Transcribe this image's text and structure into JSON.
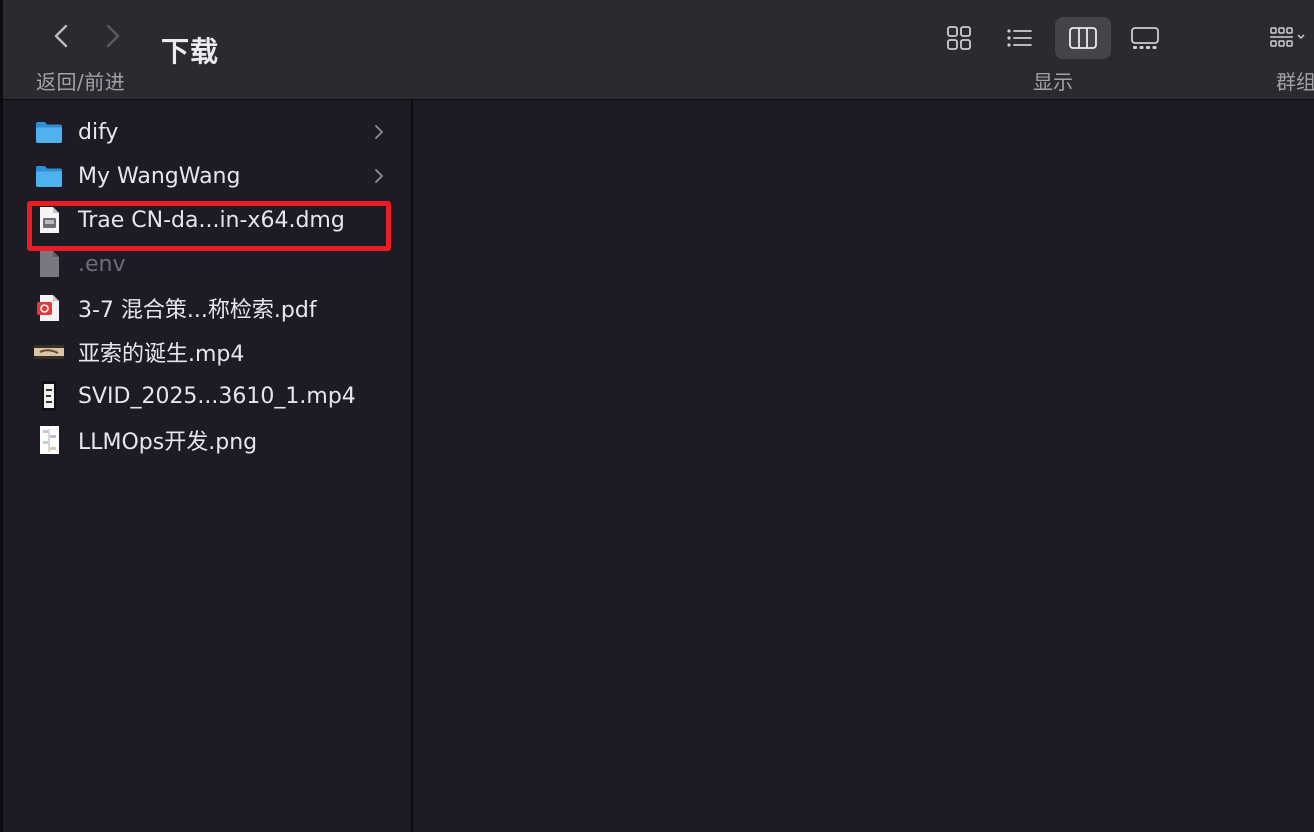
{
  "toolbar": {
    "nav_caption": "返回/前进",
    "title": "下载",
    "display_caption": "显示",
    "group_caption": "群组"
  },
  "files": [
    {
      "name": "dify",
      "kind": "folder",
      "has_children": true
    },
    {
      "name": "My WangWang",
      "kind": "folder",
      "has_children": true
    },
    {
      "name": "Trae CN-da...in-x64.dmg",
      "kind": "dmg",
      "highlighted": true
    },
    {
      "name": ".env",
      "kind": "hidden-file"
    },
    {
      "name": "3-7 混合策...称检索.pdf",
      "kind": "pdf"
    },
    {
      "name": "亚索的诞生.mp4",
      "kind": "video"
    },
    {
      "name": "SVID_2025...3610_1.mp4",
      "kind": "video-portrait"
    },
    {
      "name": "LLMOps开发.png",
      "kind": "image"
    }
  ],
  "colors": {
    "accent_highlight": "#ec1c24",
    "folder": "#3aa2e6",
    "toolbar_bg": "#2c2a31",
    "content_bg": "#1e1b24"
  }
}
